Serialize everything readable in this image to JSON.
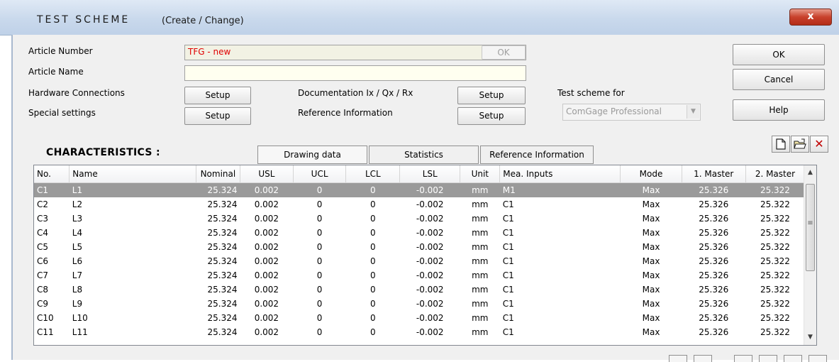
{
  "window": {
    "title": "TEST SCHEME",
    "subtitle": "(Create / Change)",
    "close_label": "x"
  },
  "form": {
    "article_number_label": "Article Number",
    "article_number_value": "TFG - new",
    "article_number_ok": "OK",
    "article_name_label": "Article Name",
    "article_name_value": "",
    "hardware_label": "Hardware Connections",
    "special_label": "Special settings",
    "documentation_label": "Documentation Ix / Qx / Rx",
    "reference_label": "Reference Information",
    "setup_label": "Setup",
    "test_scheme_for_label": "Test scheme for",
    "test_scheme_for_value": "ComGage Professional"
  },
  "side_buttons": {
    "ok": "OK",
    "cancel": "Cancel",
    "help": "Help"
  },
  "toolbar_icons": [
    "new-document-icon",
    "open-folder-icon",
    "delete-icon"
  ],
  "characteristics": {
    "title": "CHARACTERISTICS :",
    "tabs": [
      "Drawing data",
      "Statistics",
      "Reference Information"
    ],
    "active_tab": "Drawing data",
    "columns": [
      "No.",
      "Name",
      "Nominal",
      "USL",
      "UCL",
      "LCL",
      "LSL",
      "Unit",
      "Mea. Inputs",
      "Mode",
      "1. Master",
      "2. Master"
    ],
    "rows": [
      [
        "C1",
        "L1",
        "25.324",
        "0.002",
        "0",
        "0",
        "-0.002",
        "mm",
        "M1",
        "Max",
        "25.326",
        "25.322"
      ],
      [
        "C2",
        "L2",
        "25.324",
        "0.002",
        "0",
        "0",
        "-0.002",
        "mm",
        "C1",
        "Max",
        "25.326",
        "25.322"
      ],
      [
        "C3",
        "L3",
        "25.324",
        "0.002",
        "0",
        "0",
        "-0.002",
        "mm",
        "C1",
        "Max",
        "25.326",
        "25.322"
      ],
      [
        "C4",
        "L4",
        "25.324",
        "0.002",
        "0",
        "0",
        "-0.002",
        "mm",
        "C1",
        "Max",
        "25.326",
        "25.322"
      ],
      [
        "C5",
        "L5",
        "25.324",
        "0.002",
        "0",
        "0",
        "-0.002",
        "mm",
        "C1",
        "Max",
        "25.326",
        "25.322"
      ],
      [
        "C6",
        "L6",
        "25.324",
        "0.002",
        "0",
        "0",
        "-0.002",
        "mm",
        "C1",
        "Max",
        "25.326",
        "25.322"
      ],
      [
        "C7",
        "L7",
        "25.324",
        "0.002",
        "0",
        "0",
        "-0.002",
        "mm",
        "C1",
        "Max",
        "25.326",
        "25.322"
      ],
      [
        "C8",
        "L8",
        "25.324",
        "0.002",
        "0",
        "0",
        "-0.002",
        "mm",
        "C1",
        "Max",
        "25.326",
        "25.322"
      ],
      [
        "C9",
        "L9",
        "25.324",
        "0.002",
        "0",
        "0",
        "-0.002",
        "mm",
        "C1",
        "Max",
        "25.326",
        "25.322"
      ],
      [
        "C10",
        "L10",
        "25.324",
        "0.002",
        "0",
        "0",
        "-0.002",
        "mm",
        "C1",
        "Max",
        "25.326",
        "25.322"
      ],
      [
        "C11",
        "L11",
        "25.324",
        "0.002",
        "0",
        "0",
        "-0.002",
        "mm",
        "C1",
        "Max",
        "25.326",
        "25.322"
      ]
    ],
    "selected_row": 0
  },
  "colors": {
    "selected_row_bg": "#9a9a9a",
    "article_number_text": "#e00000",
    "close_button": "#c8412c"
  }
}
